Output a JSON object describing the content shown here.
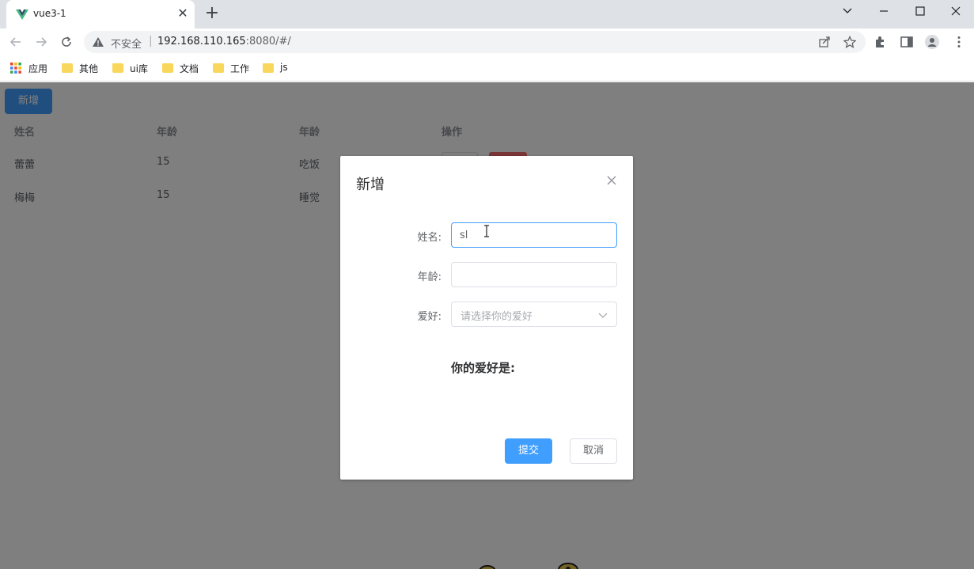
{
  "browser": {
    "tab_title": "vue3-1",
    "insecure_label": "不安全",
    "separator": "|",
    "url_host": "192.168.110.165",
    "url_rest": ":8080/#/",
    "bookmarks": [
      {
        "label": "应用",
        "icon": "apps-grid-icon"
      },
      {
        "label": "其他",
        "icon": "folder-icon"
      },
      {
        "label": "ui库",
        "icon": "folder-icon"
      },
      {
        "label": "文档",
        "icon": "folder-icon"
      },
      {
        "label": "工作",
        "icon": "folder-icon"
      },
      {
        "label": "js",
        "icon": "folder-icon"
      }
    ]
  },
  "page": {
    "add_button": "新增",
    "table": {
      "headers": [
        "姓名",
        "年龄",
        "年龄",
        "操作"
      ],
      "rows": [
        {
          "name": "蕾蕾",
          "age": "15",
          "hobby": "吃饭"
        },
        {
          "name": "梅梅",
          "age": "15",
          "hobby": "睡觉"
        }
      ]
    }
  },
  "dialog": {
    "title": "新增",
    "fields": {
      "name_label": "姓名:",
      "name_value": "sl",
      "age_label": "年龄:",
      "age_value": "",
      "hobby_label": "爱好:",
      "hobby_placeholder": "请选择你的爱好"
    },
    "hobby_display": "你的爱好是:",
    "submit_label": "提交",
    "cancel_label": "取消"
  },
  "colors": {
    "primary": "#409eff",
    "danger": "#f56c6c",
    "overlay": "rgba(0,0,0,0.5)"
  }
}
